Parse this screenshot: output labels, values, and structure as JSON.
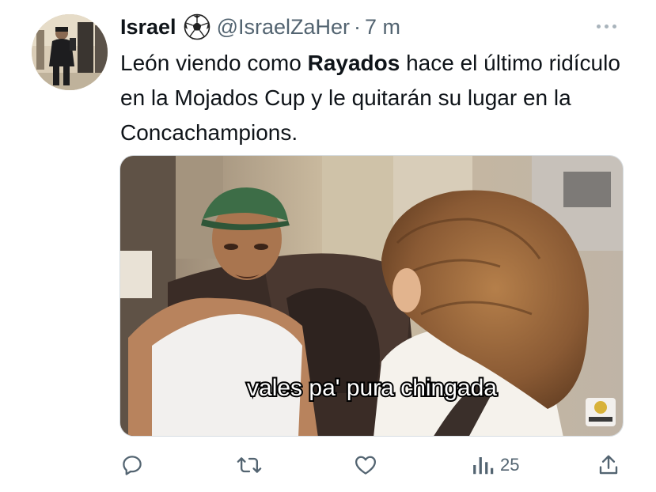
{
  "tweet": {
    "display_name": "Israel",
    "name_emoji": "soccer-ball-icon",
    "handle": "@IsraelZaHer",
    "separator": "·",
    "time": "7 m",
    "text_part1": "León viendo como ",
    "text_bold": "Rayados",
    "text_part2": " hace el último ridículo en la Mojados Cup y le quitarán su lugar en la Concachampions."
  },
  "media": {
    "caption": "vales pa' pura chingada"
  },
  "actions": {
    "reply_icon": "reply-icon",
    "retweet_icon": "retweet-icon",
    "like_icon": "like-icon",
    "views_icon": "views-icon",
    "views_count": "25",
    "share_icon": "share-icon"
  },
  "colors": {
    "text": "#0f1419",
    "secondary": "#536471"
  }
}
